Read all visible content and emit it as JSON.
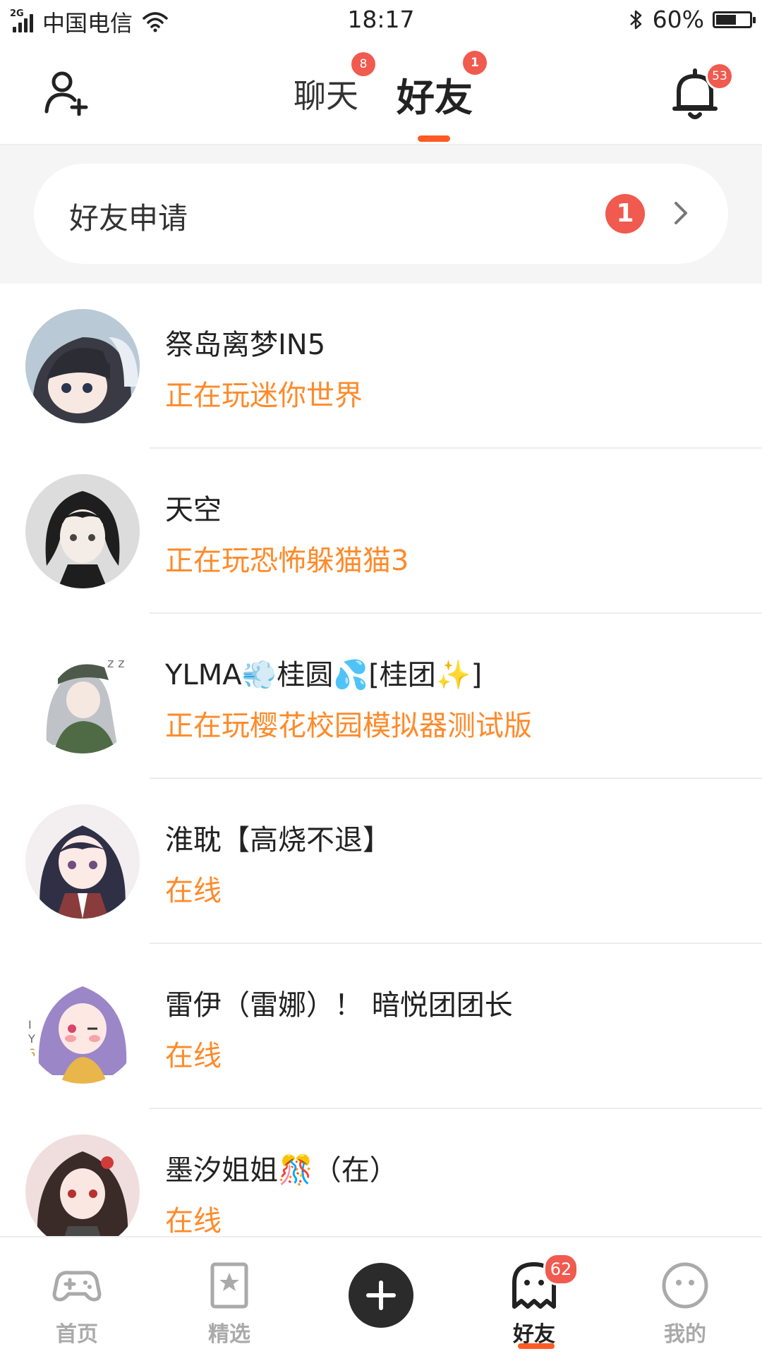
{
  "status_bar": {
    "network_tag": "2G",
    "carrier": "中国电信",
    "time": "18:17",
    "battery": "60%",
    "battery_level": 0.6
  },
  "header": {
    "tabs": [
      {
        "label": "聊天",
        "badge": "8"
      },
      {
        "label": "好友",
        "badge": "1"
      }
    ],
    "notification_badge": "53"
  },
  "friend_request": {
    "label": "好友申请",
    "count": "1"
  },
  "friends": [
    {
      "name": "祭岛离梦IN5",
      "status": "正在玩迷你世界"
    },
    {
      "name": "天空",
      "status": "正在玩恐怖躲猫猫3"
    },
    {
      "name": "YLMA💨桂圆💦[桂团✨]",
      "status": "正在玩樱花校园模拟器测试版"
    },
    {
      "name": "淮耽【高烧不退】",
      "status": "在线"
    },
    {
      "name": "雷伊（雷娜）！ 暗悦团团长",
      "status": "在线"
    },
    {
      "name": "墨汐姐姐🎊（在）",
      "status": "在线"
    }
  ],
  "bottom_nav": {
    "items": [
      {
        "label": "首页"
      },
      {
        "label": "精选"
      },
      {
        "label": "好友",
        "badge": "62"
      },
      {
        "label": "我的"
      }
    ]
  },
  "colors": {
    "accent": "#ff5a24",
    "status_orange": "#ff8a2a",
    "badge_red": "#f05a4f"
  }
}
